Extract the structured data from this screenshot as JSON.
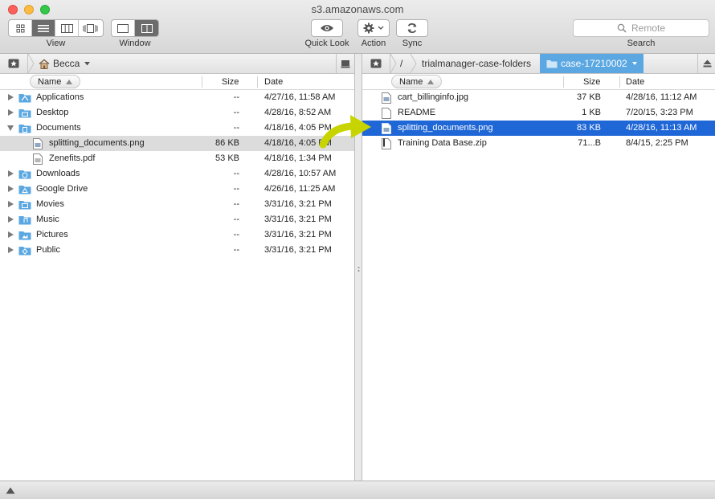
{
  "window": {
    "title": "s3.amazonaws.com"
  },
  "toolbar": {
    "view_label": "View",
    "window_label": "Window",
    "quicklook_label": "Quick Look",
    "action_label": "Action",
    "sync_label": "Sync",
    "search_label": "Search",
    "search_placeholder": "Remote"
  },
  "left": {
    "path": {
      "folder": "Becca"
    },
    "columns": {
      "name": "Name",
      "size": "Size",
      "date": "Date"
    },
    "rows": [
      {
        "name": "Applications",
        "size": "--",
        "date": "4/27/16, 11:58 AM"
      },
      {
        "name": "Desktop",
        "size": "--",
        "date": "4/28/16, 8:52 AM"
      },
      {
        "name": "Documents",
        "size": "--",
        "date": "4/18/16, 4:05 PM"
      },
      {
        "name": "splitting_documents.png",
        "size": "86 KB",
        "date": "4/18/16, 4:05 PM"
      },
      {
        "name": "Zenefits.pdf",
        "size": "53 KB",
        "date": "4/18/16, 1:34 PM"
      },
      {
        "name": "Downloads",
        "size": "--",
        "date": "4/28/16, 10:57 AM"
      },
      {
        "name": "Google Drive",
        "size": "--",
        "date": "4/26/16, 11:25 AM"
      },
      {
        "name": "Movies",
        "size": "--",
        "date": "3/31/16, 3:21 PM"
      },
      {
        "name": "Music",
        "size": "--",
        "date": "3/31/16, 3:21 PM"
      },
      {
        "name": "Pictures",
        "size": "--",
        "date": "3/31/16, 3:21 PM"
      },
      {
        "name": "Public",
        "size": "--",
        "date": "3/31/16, 3:21 PM"
      }
    ]
  },
  "right": {
    "path": {
      "root": "/",
      "parent": "trialmanager-case-folders",
      "current": "case-17210002"
    },
    "columns": {
      "name": "Name",
      "size": "Size",
      "date": "Date"
    },
    "rows": [
      {
        "name": "cart_billinginfo.jpg",
        "size": "37 KB",
        "date": "4/28/16, 11:12 AM"
      },
      {
        "name": "README",
        "size": "1 KB",
        "date": "7/20/15, 3:23 PM"
      },
      {
        "name": "splitting_documents.png",
        "size": "83 KB",
        "date": "4/28/16, 11:13 AM"
      },
      {
        "name": "Training Data Base.zip",
        "size": "71...B",
        "date": "8/4/15, 2:25 PM"
      }
    ]
  },
  "colors": {
    "selection": "#1f67d6",
    "folder": "#5aa7e2",
    "arrow": "#c8d400"
  }
}
